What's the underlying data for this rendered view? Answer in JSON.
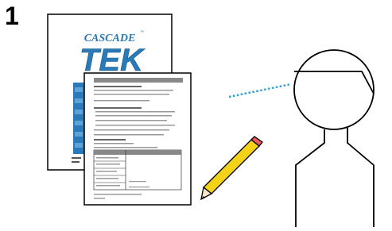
{
  "step": {
    "number": "1"
  },
  "manual_cover": {
    "brand": "CASCADE",
    "trademark": "™",
    "product": "TEK"
  },
  "colors": {
    "blue": "#2a7ab8",
    "dotted_line": "#2aa4d6",
    "pencil": "#f3d21a",
    "tip": "#e85a5a"
  }
}
